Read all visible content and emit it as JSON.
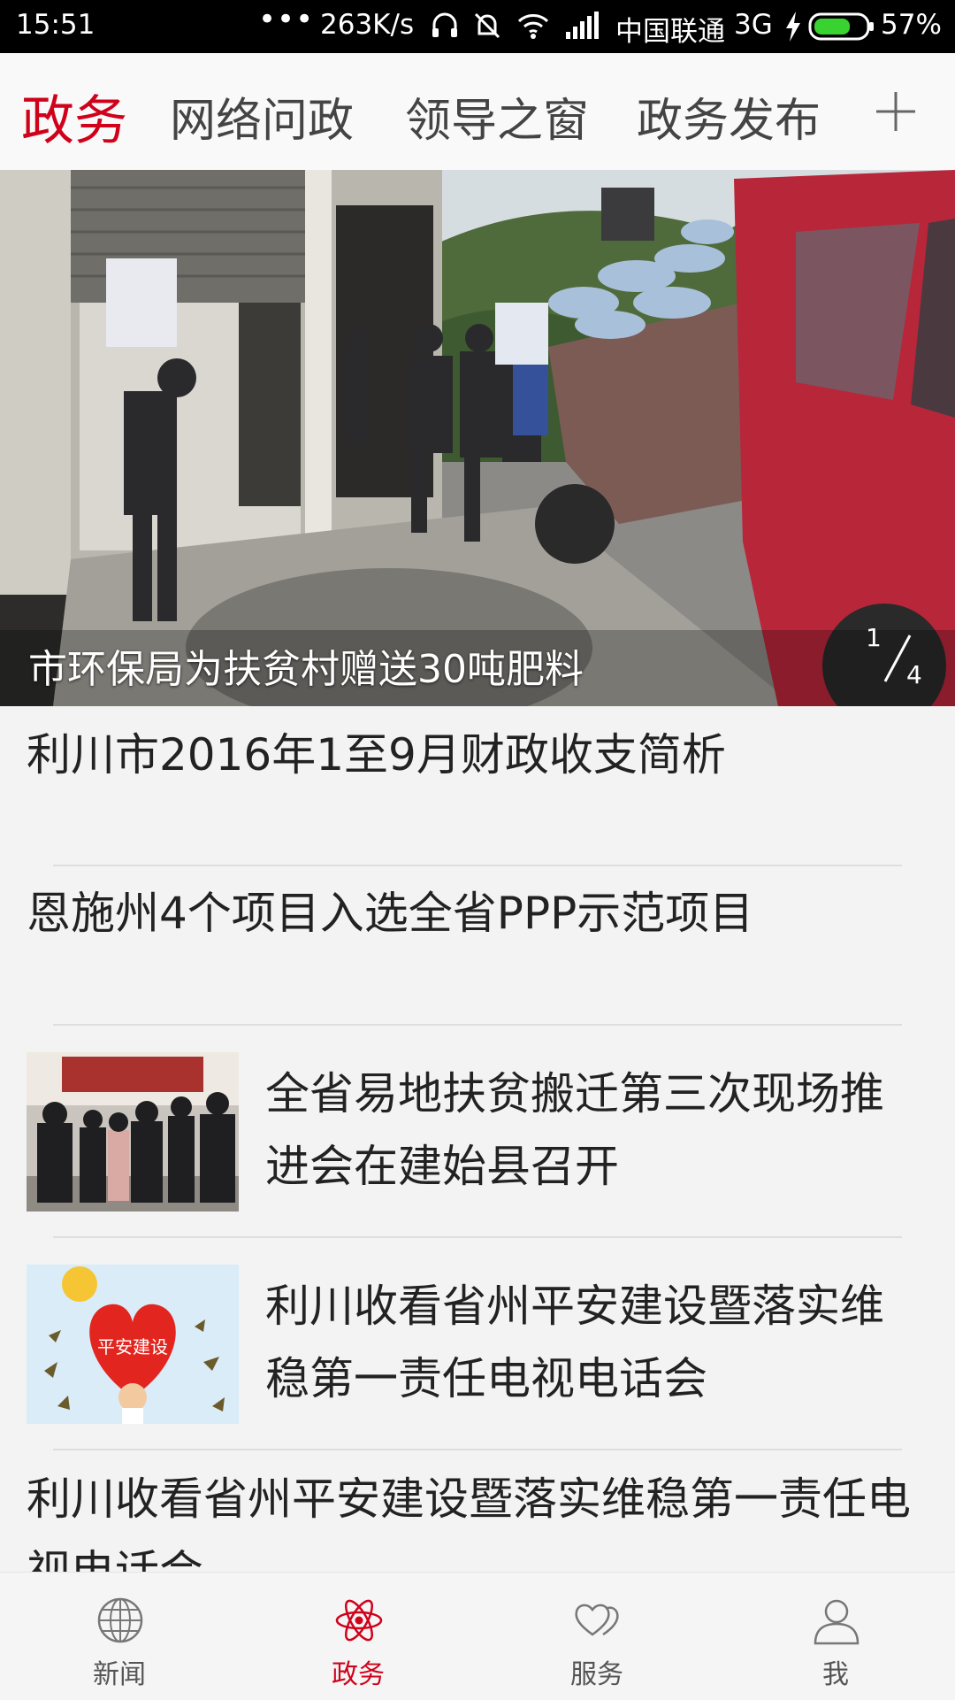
{
  "status_bar": {
    "time": "15:51",
    "dots": "•••",
    "speed": "263K/s",
    "carrier": "中国联通",
    "network": "3G",
    "battery": "57%"
  },
  "tabs": [
    {
      "label": "政务",
      "active": true
    },
    {
      "label": "网络问政",
      "active": false
    },
    {
      "label": "领导之窗",
      "active": false
    },
    {
      "label": "政务发布",
      "active": false
    }
  ],
  "carousel": {
    "caption": "市环保局为扶贫村赠送30吨肥料",
    "current": "1",
    "total": "4"
  },
  "news": [
    {
      "title": "利川市2016年1至9月财政收支简析"
    },
    {
      "title": "恩施州4个项目入选全省PPP示范项目"
    },
    {
      "title": "全省易地扶贫搬迁第三次现场推进会在建始县召开"
    },
    {
      "title": "利川收看省州平安建设暨落实维稳第一责任电视电话会"
    },
    {
      "title": "利川收看省州平安建设暨落实维稳第一责任电视电话会"
    }
  ],
  "thumb_text": "平安建设",
  "bottom_nav": [
    {
      "label": "新闻",
      "icon": "globe-icon"
    },
    {
      "label": "政务",
      "icon": "atom-icon",
      "active": true
    },
    {
      "label": "服务",
      "icon": "hearts-icon"
    },
    {
      "label": "我",
      "icon": "person-icon"
    }
  ],
  "colors": {
    "accent": "#d0021b",
    "background": "#f3f3f3"
  }
}
